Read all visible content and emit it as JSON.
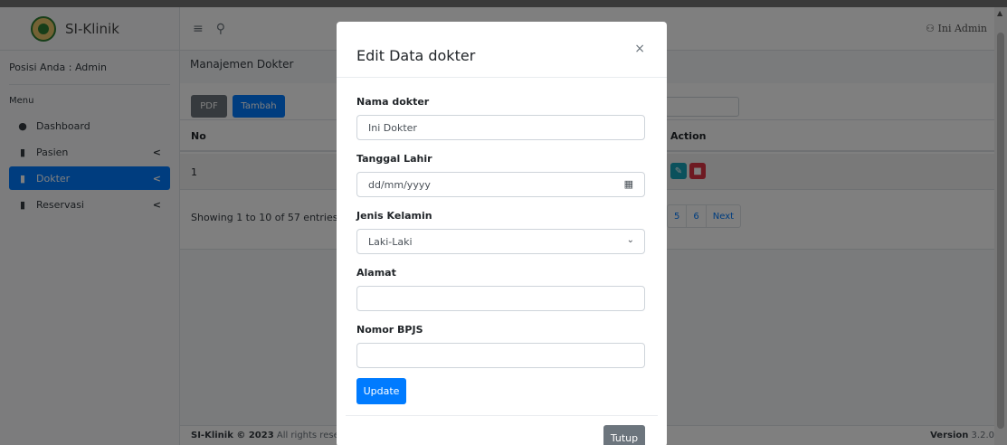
{
  "app": {
    "brand": "SI-Klinik",
    "user": "Ini Admin"
  },
  "sidebar": {
    "position_label": "Posisi Anda : Admin",
    "menu_header": "Menu",
    "items": [
      {
        "label": "Dashboard",
        "icon": "dashboard-icon",
        "active": false,
        "chevron": false
      },
      {
        "label": "Pasien",
        "icon": "copy-icon",
        "active": false,
        "chevron": true
      },
      {
        "label": "Dokter",
        "icon": "copy-icon",
        "active": true,
        "chevron": true
      },
      {
        "label": "Reservasi",
        "icon": "copy-icon",
        "active": false,
        "chevron": true
      }
    ],
    "chevron_glyph": "<"
  },
  "page": {
    "title": "Manajemen Dokter",
    "buttons": {
      "pdf": "PDF",
      "tambah": "Tambah"
    },
    "table": {
      "headers": {
        "no": "No",
        "action": "Action"
      },
      "rows": [
        {
          "no": "1"
        }
      ]
    },
    "info": "Showing 1 to 10 of 57 entries",
    "pagination": [
      "5",
      "6",
      "Next"
    ]
  },
  "footer": {
    "brand": "SI-Klinik © 2023",
    "rights": " All rights reserve",
    "version_label": "Version",
    "version": " 3.2.0"
  },
  "modal": {
    "title": "Edit Data dokter",
    "close": "×",
    "fields": {
      "nama": {
        "label": "Nama dokter",
        "value": "Ini Dokter"
      },
      "tanggal": {
        "label": "Tanggal Lahir",
        "placeholder": "dd/mm/yyyy"
      },
      "jenis": {
        "label": "Jenis Kelamin",
        "value": "Laki-Laki"
      },
      "alamat": {
        "label": "Alamat",
        "value": ""
      },
      "bpjs": {
        "label": "Nomor BPJS",
        "value": ""
      }
    },
    "update_label": "Update",
    "close_label": "Tutup"
  },
  "colors": {
    "primary": "#007bff",
    "secondary": "#6c757d",
    "edit": "#17a2b8",
    "delete": "#dc3545"
  }
}
